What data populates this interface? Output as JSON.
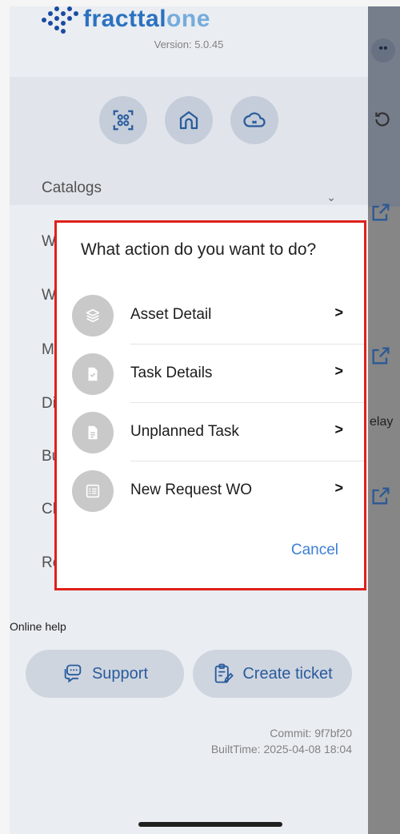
{
  "header": {
    "brand_main": "fracttal",
    "brand_accent": "one",
    "version": "Version: 5.0.45"
  },
  "drawer": {
    "menu_catalogs": "Catalogs",
    "online_help": "Online help",
    "support_label": "Support",
    "create_ticket_label": "Create ticket",
    "commit": "Commit: 9f7bf20",
    "built_time": "BuiltTime: 2025-04-08 18:04",
    "partial_letters": [
      "W",
      "W",
      "M",
      "Di",
      "Bu",
      "Cl",
      "Re"
    ]
  },
  "background_app": {
    "partial_text": "elay"
  },
  "dialog": {
    "title": "What action do you want to do?",
    "options": [
      {
        "label": "Asset Detail",
        "icon": "layers-icon"
      },
      {
        "label": "Task Details",
        "icon": "task-doc-icon"
      },
      {
        "label": "Unplanned Task",
        "icon": "document-icon"
      },
      {
        "label": "New Request WO",
        "icon": "list-icon"
      }
    ],
    "cancel_label": "Cancel"
  },
  "colors": {
    "brand_blue": "#2c76c9",
    "accent_red_border": "#e0201a",
    "cancel_blue": "#3c7fd6"
  }
}
